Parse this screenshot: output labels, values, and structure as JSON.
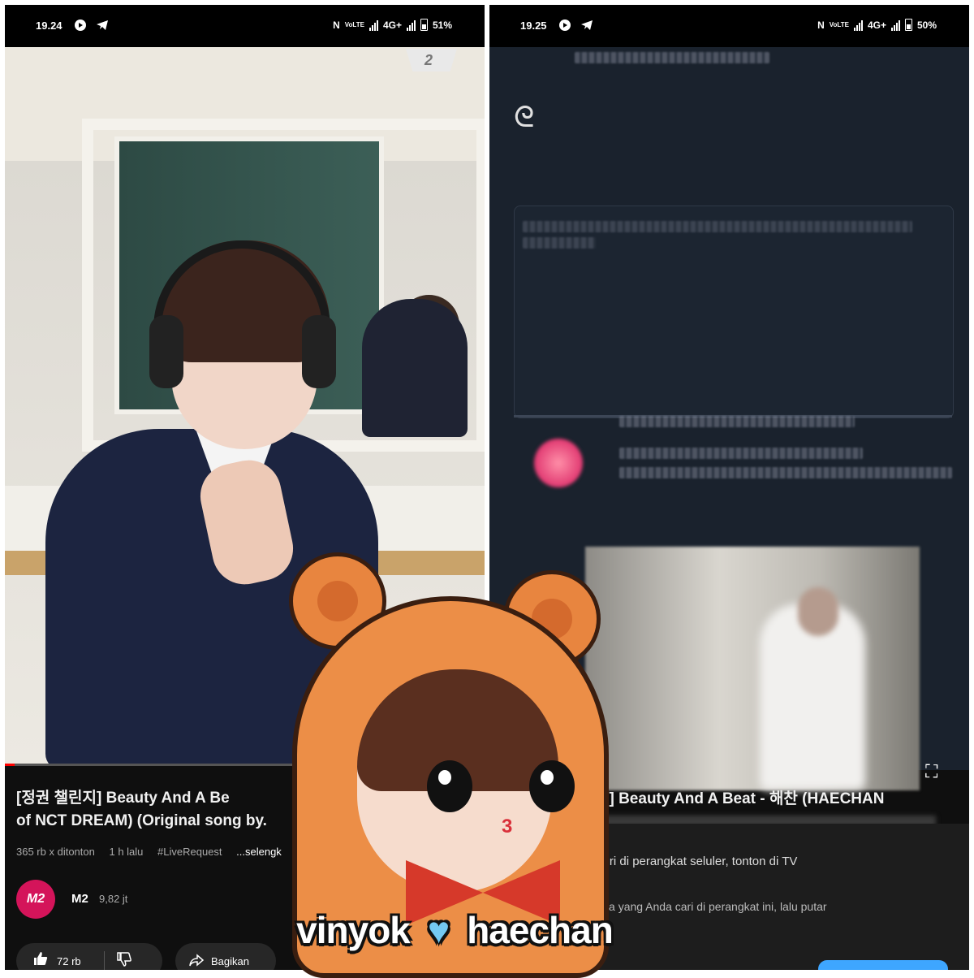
{
  "left": {
    "status": {
      "time": "19.24",
      "network": "4G+",
      "battery": "51%"
    },
    "watermark": "2",
    "video": {
      "progress": 0.02
    },
    "title": "[정권 챌린지] Beauty And A Beat - 해찬 (HAECHAN of NCT DREAM) (Original song by...",
    "title_visible_line1": "[정권 챌린지] Beauty And A Be",
    "title_visible_line2": "of NCT DREAM) (Original song by.",
    "meta": {
      "views": "365 rb x ditonton",
      "age": "1 h lalu",
      "tag": "#LiveRequest",
      "more": "...selengk"
    },
    "channel": {
      "avatar_text": "M2",
      "name": "M2",
      "subscribers": "9,82 jt"
    },
    "actions": {
      "like_icon": "thumb-up-icon",
      "likes": "72 rb",
      "dislike_icon": "thumb-down-icon",
      "share_icon": "share-icon",
      "share_label": "Bagikan"
    }
  },
  "right": {
    "status": {
      "time": "19.25",
      "network": "4G+",
      "battery": "50%"
    },
    "title": "지] Beauty And A Beat - 해찬 (HAECHAN",
    "cast_line_1": "elusuri di perangkat seluler, tonton di TV",
    "cast_line_2": "an apa yang Anda cari di perangkat ini, lalu putar",
    "fullscreen_icon": "fullscreen-icon"
  },
  "sticker": {
    "caption_left": "vinyok",
    "caption_right": "haechan",
    "heart_icon": "heart-icon",
    "heart_color": "#74c9f2",
    "face_mark": "3"
  },
  "colors": {
    "progress": "#ff0000",
    "channel_avatar": "#d4145a",
    "background": "#0f0f0f",
    "cast_button": "#3ea6ff"
  }
}
